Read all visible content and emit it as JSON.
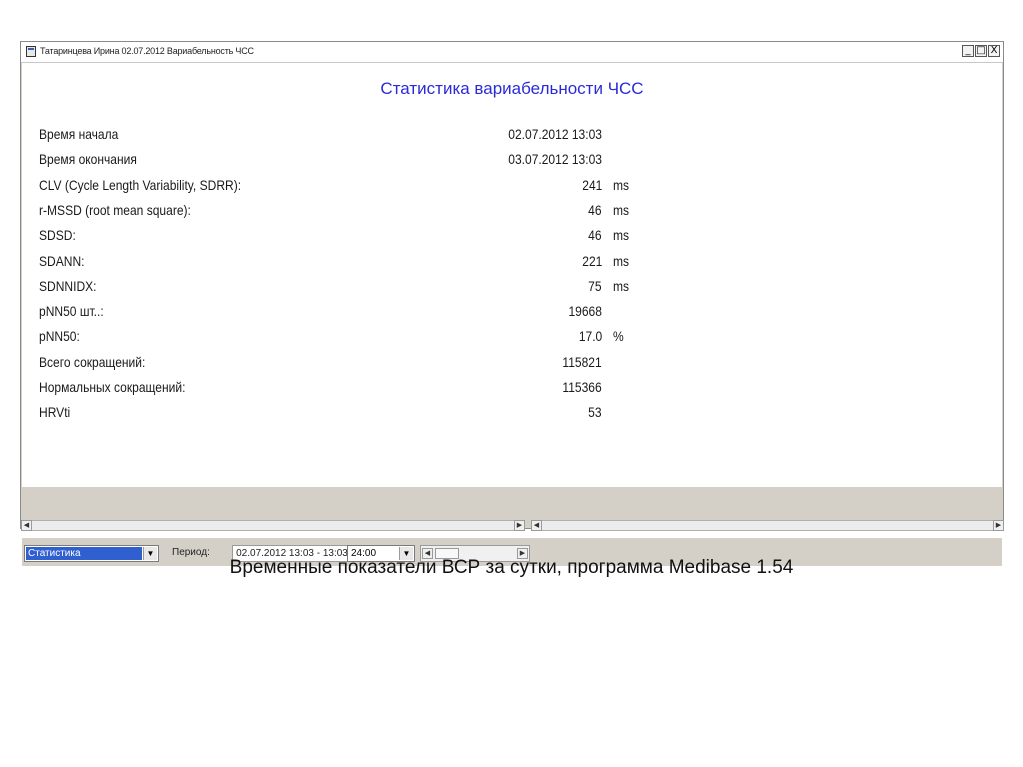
{
  "window": {
    "title": "Татаринцева Ирина 02.07.2012 Вариабельность ЧСС",
    "controls": [
      "_",
      "□",
      "X"
    ]
  },
  "report": {
    "heading": "Статистика вариабельности ЧСС",
    "rows": [
      {
        "label": "Время начала",
        "value": "02.07.2012 13:03",
        "unit": ""
      },
      {
        "label": "Время окончания",
        "value": "03.07.2012 13:03",
        "unit": ""
      },
      {
        "label": "CLV (Cycle Length Variability, SDRR):",
        "value": "241",
        "unit": "ms"
      },
      {
        "label": "r-MSSD (root mean square):",
        "value": "46",
        "unit": "ms"
      },
      {
        "label": "SDSD:",
        "value": "46",
        "unit": "ms"
      },
      {
        "label": "SDANN:",
        "value": "221",
        "unit": "ms"
      },
      {
        "label": "SDNNIDX:",
        "value": "75",
        "unit": "ms"
      },
      {
        "label": "pNN50 шт..:",
        "value": "19668",
        "unit": ""
      },
      {
        "label": "pNN50:",
        "value": "17.0",
        "unit": "%"
      },
      {
        "label": "Всего сокращений:",
        "value": "115821",
        "unit": ""
      },
      {
        "label": "Нормальных сокращений:",
        "value": "115366",
        "unit": ""
      },
      {
        "label": "HRVti",
        "value": "53",
        "unit": ""
      }
    ]
  },
  "statusbar": {
    "view_select": "Статистика",
    "period_label": "Период:",
    "period_value": "02.07.2012 13:03 - 13:03",
    "duration_select": "24:00"
  },
  "caption": "Временные показатели ВСР за сутки, программа Medibase 1.54"
}
